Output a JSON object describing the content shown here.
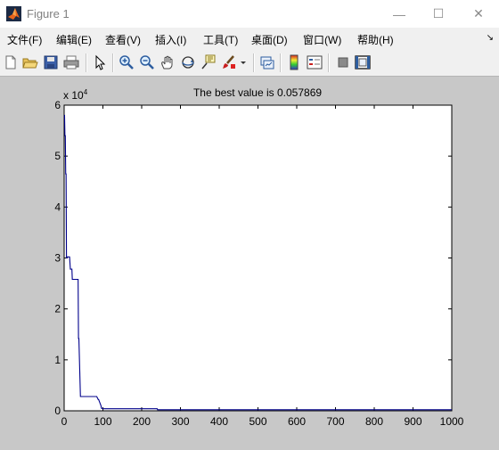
{
  "window": {
    "title": "Figure 1",
    "minimize_glyph": "—",
    "maximize_glyph": "☐",
    "close_glyph": "✕"
  },
  "menu": {
    "items": [
      "文件(F)",
      "编辑(E)",
      "查看(V)",
      "插入(I)",
      "工具(T)",
      "桌面(D)",
      "窗口(W)",
      "帮助(H)"
    ],
    "overflow_glyph": "↘"
  },
  "toolbar": {
    "icons": [
      "new-figure-icon",
      "open-file-icon",
      "save-icon",
      "print-icon",
      "select-arrow-icon",
      "zoom-in-icon",
      "zoom-out-icon",
      "pan-hand-icon",
      "rotate-3d-icon",
      "data-cursor-icon",
      "brush-icon",
      "dropdown-arrow-icon",
      "link-plot-icon",
      "colorbar-icon",
      "legend-icon",
      "hide-plot-tools-icon",
      "show-plot-tools-icon"
    ]
  },
  "chart_data": {
    "type": "line",
    "title": "The best value is 0.057869",
    "xlabel": "",
    "ylabel": "",
    "y_exponent_label": "x 10",
    "y_exponent": "4",
    "xlim": [
      0,
      1000
    ],
    "ylim": [
      0,
      6
    ],
    "x_ticks": [
      0,
      100,
      200,
      300,
      400,
      500,
      600,
      700,
      800,
      900,
      1000
    ],
    "y_ticks": [
      0,
      1,
      2,
      3,
      4,
      5,
      6
    ],
    "grid": false,
    "line_color": "#00008b",
    "series": [
      {
        "x": [
          0,
          1,
          2,
          3,
          4,
          5,
          6,
          7,
          8,
          9,
          14,
          16,
          20,
          21,
          24,
          25,
          36,
          37,
          38,
          42,
          84,
          88,
          89,
          95,
          96,
          100,
          240,
          241,
          1000
        ],
        "y": [
          5.8,
          5.8,
          5.4,
          5.4,
          4.65,
          4.65,
          3.0,
          3.0,
          3.02,
          3.02,
          3.02,
          2.78,
          2.78,
          2.58,
          2.58,
          2.58,
          2.58,
          1.42,
          1.42,
          0.28,
          0.28,
          0.22,
          0.22,
          0.1,
          0.05,
          0.04,
          0.04,
          0.02,
          0.02
        ]
      }
    ]
  }
}
